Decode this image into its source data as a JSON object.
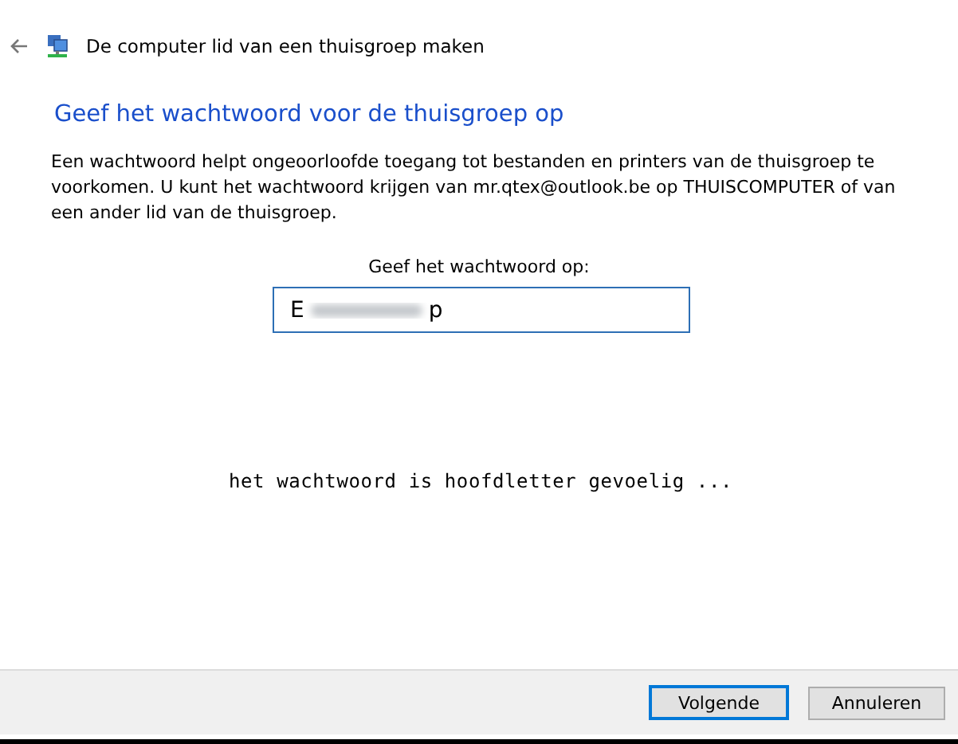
{
  "window": {
    "title": "De computer lid van een thuisgroep maken"
  },
  "heading": "Geef het wachtwoord voor de thuisgroep op",
  "description": "Een wachtwoord helpt ongeoorloofde toegang tot bestanden en printers van de thuisgroep te voorkomen. U kunt het wachtwoord krijgen van mr.qtex@outlook.be op THUISCOMPUTER of van een ander lid van de thuisgroep.",
  "password_label": "Geef het wachtwoord op:",
  "password_field": {
    "value_start": "E",
    "value_end": "p",
    "focused": true
  },
  "hint": "het wachtwoord is hoofdletter gevoelig ...",
  "buttons": [
    {
      "label": "Volgende",
      "default": true
    },
    {
      "label": "Annuleren",
      "default": false
    }
  ]
}
